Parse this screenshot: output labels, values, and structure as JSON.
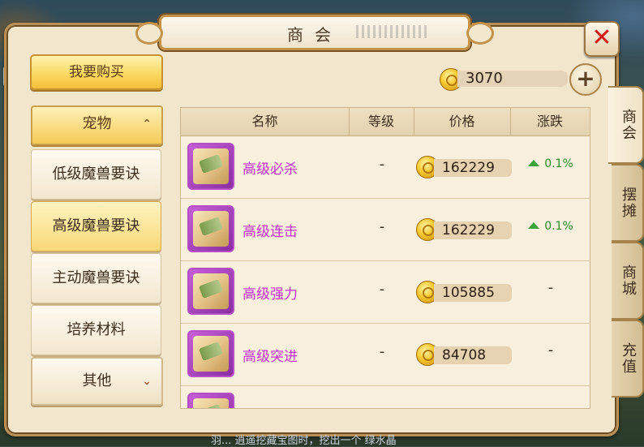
{
  "window": {
    "title": "商会",
    "close_label": "✕"
  },
  "toolbar": {
    "buy_label": "我要购买",
    "balance": "3070",
    "plus_label": "+"
  },
  "categories": {
    "head": {
      "label": "宠物",
      "chevron": "⌃"
    },
    "items": [
      {
        "label": "低级魔兽要诀",
        "active": false
      },
      {
        "label": "高级魔兽要诀",
        "active": true
      },
      {
        "label": "主动魔兽要诀",
        "active": false
      },
      {
        "label": "培养材料",
        "active": false
      }
    ],
    "other": {
      "label": "其他",
      "chevron": "⌄"
    }
  },
  "table": {
    "headers": {
      "name": "名称",
      "level": "等级",
      "price": "价格",
      "change": "涨跌"
    },
    "rows": [
      {
        "name": "高级必杀",
        "level": "-",
        "price": "162229",
        "change": "0.1%",
        "up": true
      },
      {
        "name": "高级连击",
        "level": "-",
        "price": "162229",
        "change": "0.1%",
        "up": true
      },
      {
        "name": "高级强力",
        "level": "-",
        "price": "105885",
        "change": "-",
        "up": false
      },
      {
        "name": "高级突进",
        "level": "-",
        "price": "84708",
        "change": "-",
        "up": false
      }
    ]
  },
  "side_tabs": [
    {
      "label": "商会",
      "active": true
    },
    {
      "label": "摆摊",
      "active": false
    },
    {
      "label": "商城",
      "active": false
    },
    {
      "label": "充值",
      "active": false
    }
  ],
  "chat": {
    "text": "羽... 逍遥挖藏宝图时，挖出一个 绿水晶"
  },
  "colors": {
    "item_name": "#c22fd4",
    "change_up": "#2c8c2c",
    "close": "#d21a1a"
  },
  "icons": {
    "coin": "gold-coin-icon",
    "scroll": "skill-scroll-icon",
    "arrow": "green-up-arrow-icon"
  }
}
